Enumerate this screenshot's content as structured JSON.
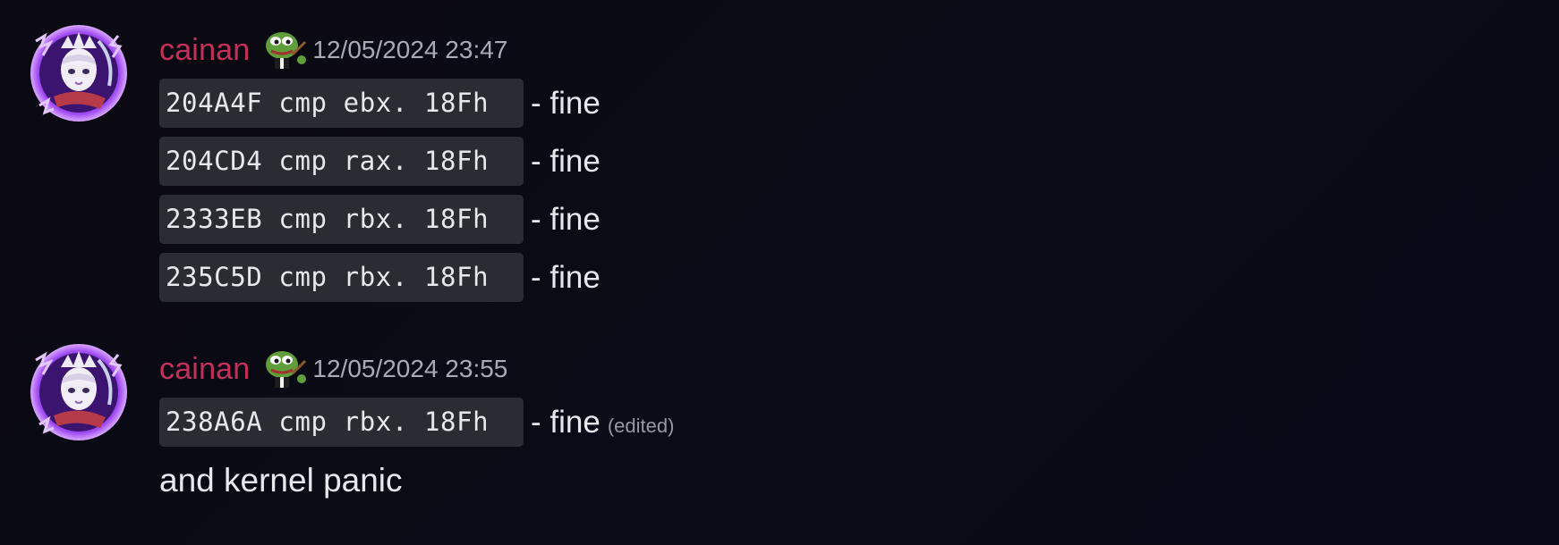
{
  "messages": [
    {
      "username": "cainan",
      "timestamp": "12/05/2024 23:47",
      "lines": [
        {
          "code": "204A4F cmp ebx. 18Fh",
          "text": "- fine"
        },
        {
          "code": "204CD4 cmp rax. 18Fh",
          "text": "- fine"
        },
        {
          "code": "2333EB cmp rbx. 18Fh",
          "text": "- fine"
        },
        {
          "code": "235C5D cmp rbx. 18Fh",
          "text": "- fine"
        }
      ]
    },
    {
      "username": "cainan",
      "timestamp": "12/05/2024 23:55",
      "lines": [
        {
          "code": "238A6A cmp rbx. 18Fh",
          "text": "- fine",
          "edited": "(edited)"
        }
      ],
      "plain": "and kernel panic"
    }
  ],
  "icons": {
    "avatar": "anime-avatar-purple-lightning",
    "role_icon": "pepe-frog-icon"
  },
  "colors": {
    "background": "#0a0b14",
    "username": "#c5305a",
    "timestamp": "#a8aab8",
    "code_bg": "#2b2c33",
    "text": "#e6e8ee"
  }
}
